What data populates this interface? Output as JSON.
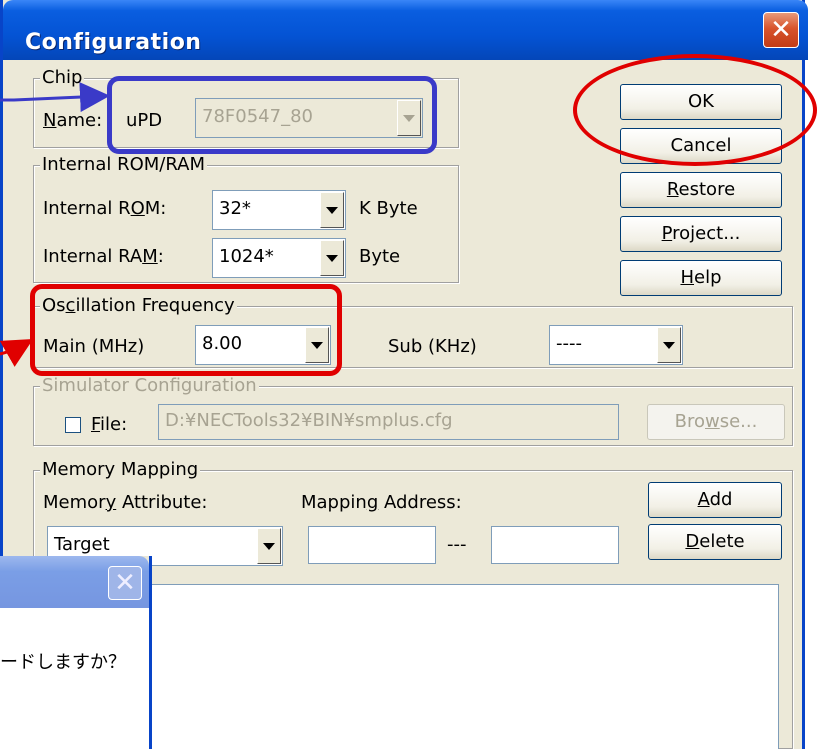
{
  "window": {
    "title": "Configuration",
    "close_glyph": "✕"
  },
  "chip": {
    "group_label": "Chip",
    "name_label_pre": "",
    "name_label_ul": "N",
    "name_label_post": "ame:",
    "name_prefix": "uPD",
    "name_value": "78F0547_80"
  },
  "rom_ram": {
    "group_label": "Internal ROM/RAM",
    "rom_label_pre": "Internal R",
    "rom_label_ul": "O",
    "rom_label_post": "M:",
    "rom_value": "32*",
    "rom_unit": "K Byte",
    "ram_label_pre": "Internal RA",
    "ram_label_ul": "M",
    "ram_label_post": ":",
    "ram_value": "1024*",
    "ram_unit": "Byte"
  },
  "osc": {
    "group_label_pre": "Os",
    "group_label_ul": "c",
    "group_label_post": "illation Frequency",
    "main_label": "Main (MHz)",
    "main_value": "8.00",
    "sub_label": "Sub (KHz)",
    "sub_value": "----"
  },
  "sim": {
    "group_label": "Simulator Configuration",
    "file_label_ul": "F",
    "file_label_post": "ile:",
    "file_path": "D:¥NECTools32¥BIN¥smplus.cfg",
    "browse_pre": "Bro",
    "browse_ul": "w",
    "browse_post": "se..."
  },
  "mem": {
    "group_label": "Memory Mapping",
    "attr_label_pre": "Memor",
    "attr_label_ul": "y",
    "attr_label_post": " Attribute:",
    "attr_value": "Target",
    "addr_label_pre": "Mappin",
    "addr_label_ul": "g",
    "addr_label_post": " Address:",
    "addr_from": "",
    "addr_sep": "---",
    "addr_to": "",
    "add_ul": "A",
    "add_post": "dd",
    "delete_ul": "D",
    "delete_post": "elete"
  },
  "buttons": {
    "ok": "OK",
    "cancel": "Cancel",
    "restore_ul": "R",
    "restore_post": "estore",
    "project_ul": "P",
    "project_post": "roject...",
    "help_ul": "H",
    "help_post": "elp"
  },
  "dialog2": {
    "close_glyph": "✕",
    "message": "ードしますか？"
  },
  "colors": {
    "titlebar": "#0453d4",
    "dialog_face": "#ece9d8",
    "callout_blue": "#3a3ac8",
    "callout_red": "#e00000"
  }
}
